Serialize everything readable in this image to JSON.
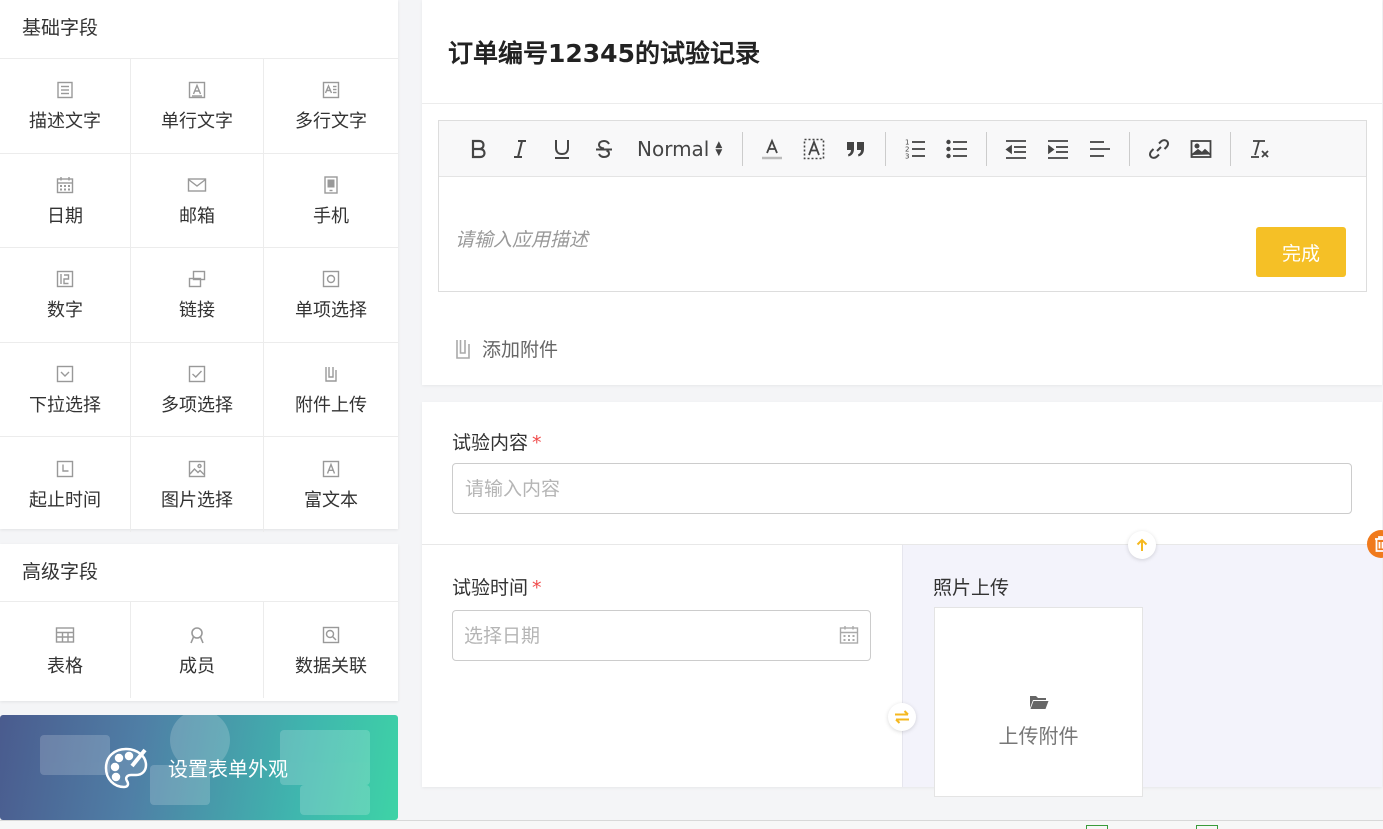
{
  "basic_fields": {
    "title": "基础字段",
    "items": [
      {
        "label": "描述文字",
        "icon": "description-icon"
      },
      {
        "label": "单行文字",
        "icon": "single-line-text-icon"
      },
      {
        "label": "多行文字",
        "icon": "multi-line-text-icon"
      },
      {
        "label": "日期",
        "icon": "calendar-icon"
      },
      {
        "label": "邮箱",
        "icon": "mail-icon"
      },
      {
        "label": "手机",
        "icon": "phone-icon"
      },
      {
        "label": "数字",
        "icon": "number-icon"
      },
      {
        "label": "链接",
        "icon": "link-icon"
      },
      {
        "label": "单项选择",
        "icon": "radio-icon"
      },
      {
        "label": "下拉选择",
        "icon": "dropdown-icon"
      },
      {
        "label": "多项选择",
        "icon": "checkbox-icon"
      },
      {
        "label": "附件上传",
        "icon": "attachment-icon"
      },
      {
        "label": "起止时间",
        "icon": "clock-icon"
      },
      {
        "label": "图片选择",
        "icon": "image-icon"
      },
      {
        "label": "富文本",
        "icon": "rich-text-icon"
      }
    ]
  },
  "advanced_fields": {
    "title": "高级字段",
    "items": [
      {
        "label": "表格",
        "icon": "table-icon"
      },
      {
        "label": "成员",
        "icon": "member-icon"
      },
      {
        "label": "数据关联",
        "icon": "data-link-icon"
      }
    ]
  },
  "banner": {
    "label": "设置表单外观",
    "icon": "palette-icon"
  },
  "form_header": {
    "title": "订单编号12345的试验记录",
    "editor": {
      "format_select": "Normal",
      "placeholder": "请输入应用描述",
      "done_label": "完成"
    },
    "attach_label": "添加附件"
  },
  "form_body": {
    "content_field": {
      "label": "试验内容",
      "required_mark": "*",
      "placeholder": "请输入内容"
    },
    "time_field": {
      "label": "试验时间",
      "required_mark": "*",
      "placeholder": "选择日期"
    },
    "photo_field": {
      "label": "照片上传",
      "upload_label": "上传附件"
    }
  },
  "colors": {
    "accent": "#f5c026",
    "required": "#f04a4a",
    "delete": "#f07a1c",
    "banner_from": "#4a5b8e",
    "banner_to": "#3ed3a6"
  }
}
